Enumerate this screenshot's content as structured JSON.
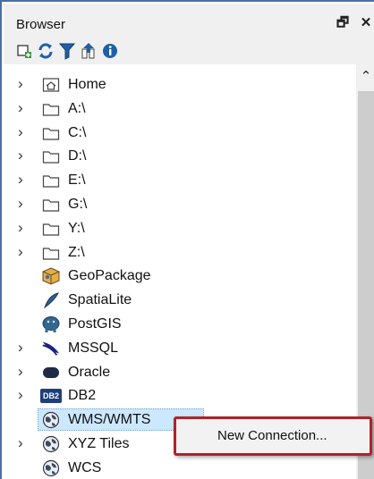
{
  "panel": {
    "title": "Browser",
    "float_glyph": "🗗",
    "close_glyph": "✕"
  },
  "toolbar": [
    {
      "name": "add-selected-layers-icon"
    },
    {
      "name": "refresh-icon"
    },
    {
      "name": "filter-icon"
    },
    {
      "name": "collapse-all-icon"
    },
    {
      "name": "info-icon"
    }
  ],
  "tree": {
    "items": [
      {
        "label": "Home",
        "icon": "home-folder-icon",
        "expandable": true
      },
      {
        "label": "A:\\",
        "icon": "folder-icon",
        "expandable": true
      },
      {
        "label": "C:\\",
        "icon": "folder-icon",
        "expandable": true
      },
      {
        "label": "D:\\",
        "icon": "folder-icon",
        "expandable": true
      },
      {
        "label": "E:\\",
        "icon": "folder-icon",
        "expandable": true
      },
      {
        "label": "G:\\",
        "icon": "folder-icon",
        "expandable": true
      },
      {
        "label": "Y:\\",
        "icon": "folder-icon",
        "expandable": true
      },
      {
        "label": "Z:\\",
        "icon": "folder-icon",
        "expandable": true
      },
      {
        "label": "GeoPackage",
        "icon": "geopackage-icon",
        "expandable": false
      },
      {
        "label": "SpatiaLite",
        "icon": "spatialite-icon",
        "expandable": false
      },
      {
        "label": "PostGIS",
        "icon": "postgis-elephant-icon",
        "expandable": false
      },
      {
        "label": "MSSQL",
        "icon": "mssql-icon",
        "expandable": true
      },
      {
        "label": "Oracle",
        "icon": "oracle-icon",
        "expandable": true
      },
      {
        "label": "DB2",
        "icon": "db2-icon",
        "icon_text": "DB2",
        "expandable": true
      },
      {
        "label": "WMS/WMTS",
        "icon": "globe-icon",
        "expandable": false,
        "selected": true
      },
      {
        "label": "XYZ Tiles",
        "icon": "globe-icon",
        "expandable": true
      },
      {
        "label": "WCS",
        "icon": "globe-icon",
        "expandable": false
      }
    ]
  },
  "context_menu": {
    "items": [
      {
        "label": "New Connection..."
      }
    ]
  },
  "colors": {
    "selection": "#cce8ff",
    "menu_highlight_border": "#b0232a",
    "frame_border": "#4a6fa5"
  }
}
